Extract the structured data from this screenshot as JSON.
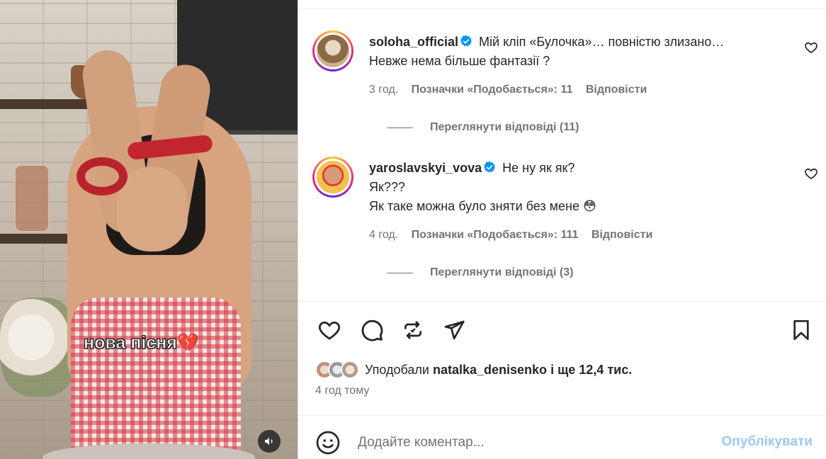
{
  "media": {
    "caption_text": "нова пісня",
    "caption_emoji": "💔",
    "mute_icon": "speaker-icon"
  },
  "comments": [
    {
      "username": "soloha_official",
      "verified": true,
      "lines": [
        "Мій кліп «Булочка»… повністю злизано…",
        "Невже нема більше фантазії ?"
      ],
      "time": "3 год.",
      "likes": "Позначки «Подобається»: 11",
      "reply_label": "Відповісти",
      "view_replies": "Переглянути відповіді (11)"
    },
    {
      "username": "yaroslavskyi_vova",
      "verified": true,
      "lines": [
        "Не ну як як?",
        "Як???",
        "Як таке можна було зняти без мене"
      ],
      "emoji": "😳",
      "time": "4 год.",
      "likes": "Позначки «Подобається»: 111",
      "reply_label": "Відповісти",
      "view_replies": "Переглянути відповіді (3)"
    }
  ],
  "likes": {
    "prefix": "Уподобали",
    "user": "natalka_denisenko",
    "suffix": "і ще 12,4 тис."
  },
  "post_time": "4 год тому",
  "add_comment": {
    "placeholder": "Додайте коментар...",
    "publish_label": "Опублікувати"
  },
  "colors": {
    "verified": "#0095f6",
    "publish_disabled": "#9cc9f8",
    "meta_text": "#737373"
  }
}
